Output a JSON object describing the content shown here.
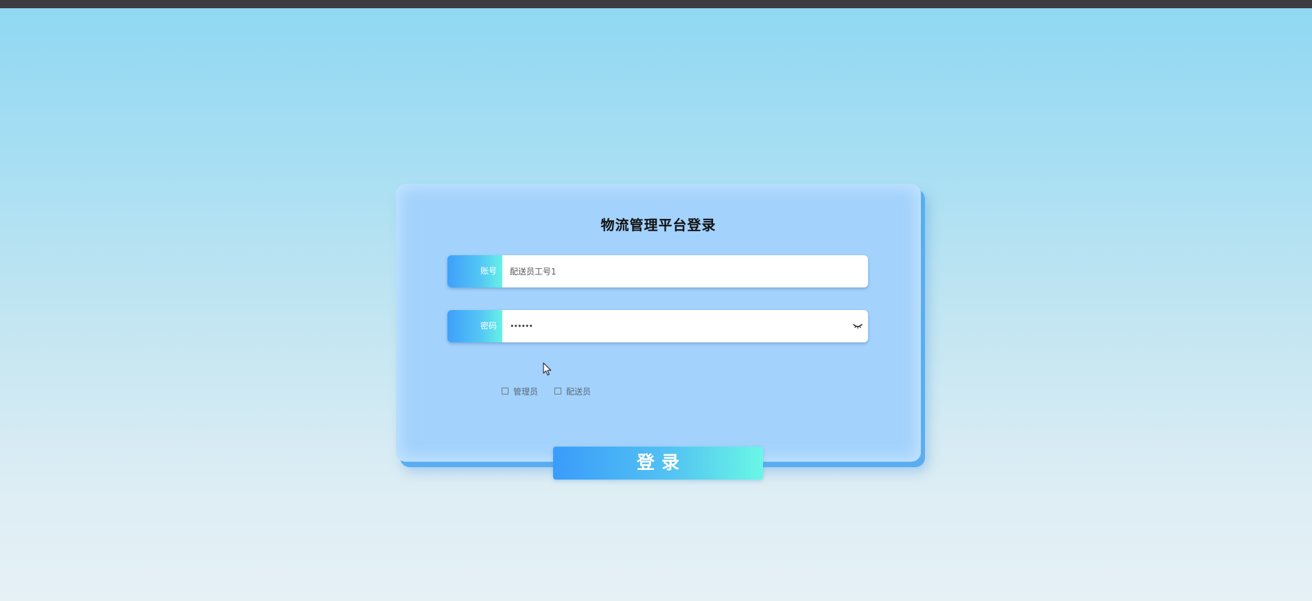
{
  "login": {
    "title": "物流管理平台登录",
    "account": {
      "label": "账号",
      "value": "配送员工号1"
    },
    "password": {
      "label": "密码",
      "value": "••••••",
      "toggle_icon": "eye-closed-icon"
    },
    "roles": [
      {
        "label": "管理员",
        "checked": false
      },
      {
        "label": "配送员",
        "checked": false
      }
    ],
    "submit_label": "登录"
  },
  "colors": {
    "accent_start": "#3ea0fb",
    "accent_end": "#66f1e6",
    "card_bg": "#a3d2fc",
    "card_edge": "#5aaef0"
  }
}
